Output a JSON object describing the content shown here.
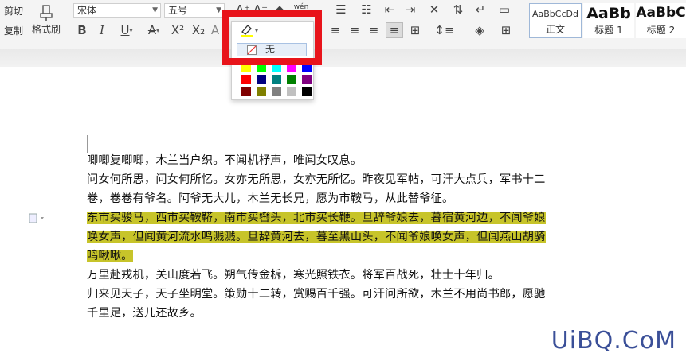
{
  "clipboard": {
    "cut_label": "剪切",
    "copy_label": "复制",
    "format_painter_label": "格式刷"
  },
  "font": {
    "name": "宋体",
    "size": "五号",
    "pinyin_label": "wén"
  },
  "styles": [
    {
      "sample": "AaBbCcDd",
      "name": "正文"
    },
    {
      "sample": "AaBb",
      "name": "标题 1"
    },
    {
      "sample": "AaBbC",
      "name": "标题 2"
    }
  ],
  "highlight_menu": {
    "none_label": "无",
    "colors": [
      "#ffff00",
      "#00ff00",
      "#00ffff",
      "#ff00ff",
      "#0000ff",
      "#ff0000",
      "#000080",
      "#008080",
      "#008000",
      "#800080",
      "#800000",
      "#808000",
      "#808080",
      "#c0c0c0",
      "#000000"
    ],
    "highlight_color": "#c7c42a",
    "callout_color": "#e8141b"
  },
  "document": {
    "lines": [
      "唧唧复唧唧，木兰当户织。不闻机杼声，唯闻女叹息。",
      "问女何所思，问女何所忆。女亦无所思，女亦无所忆。昨夜见军帖，可汗大点兵，军书十二",
      "卷，卷卷有爷名。阿爷无大儿，木兰无长兄，愿为市鞍马，从此替爷征。",
      "东市买骏马，西市买鞍鞯，南市买辔头，北市买长鞭。旦辞爷娘去，暮宿黄河边，不闻爷娘",
      "唤女声，但闻黄河流水鸣溅溅。旦辞黄河去，暮至黑山头，不闻爷娘唤女声，但闻燕山胡骑",
      "鸣啾啾。",
      "万里赴戎机，关山度若飞。朔气传金柝，寒光照铁衣。将军百战死，壮士十年归。",
      "归来见天子，天子坐明堂。策勋十二转，赏赐百千强。可汗问所欲，木兰不用尚书郎，愿驰",
      "千里足，送儿还故乡。"
    ]
  },
  "watermark": "UiBQ.CoM"
}
